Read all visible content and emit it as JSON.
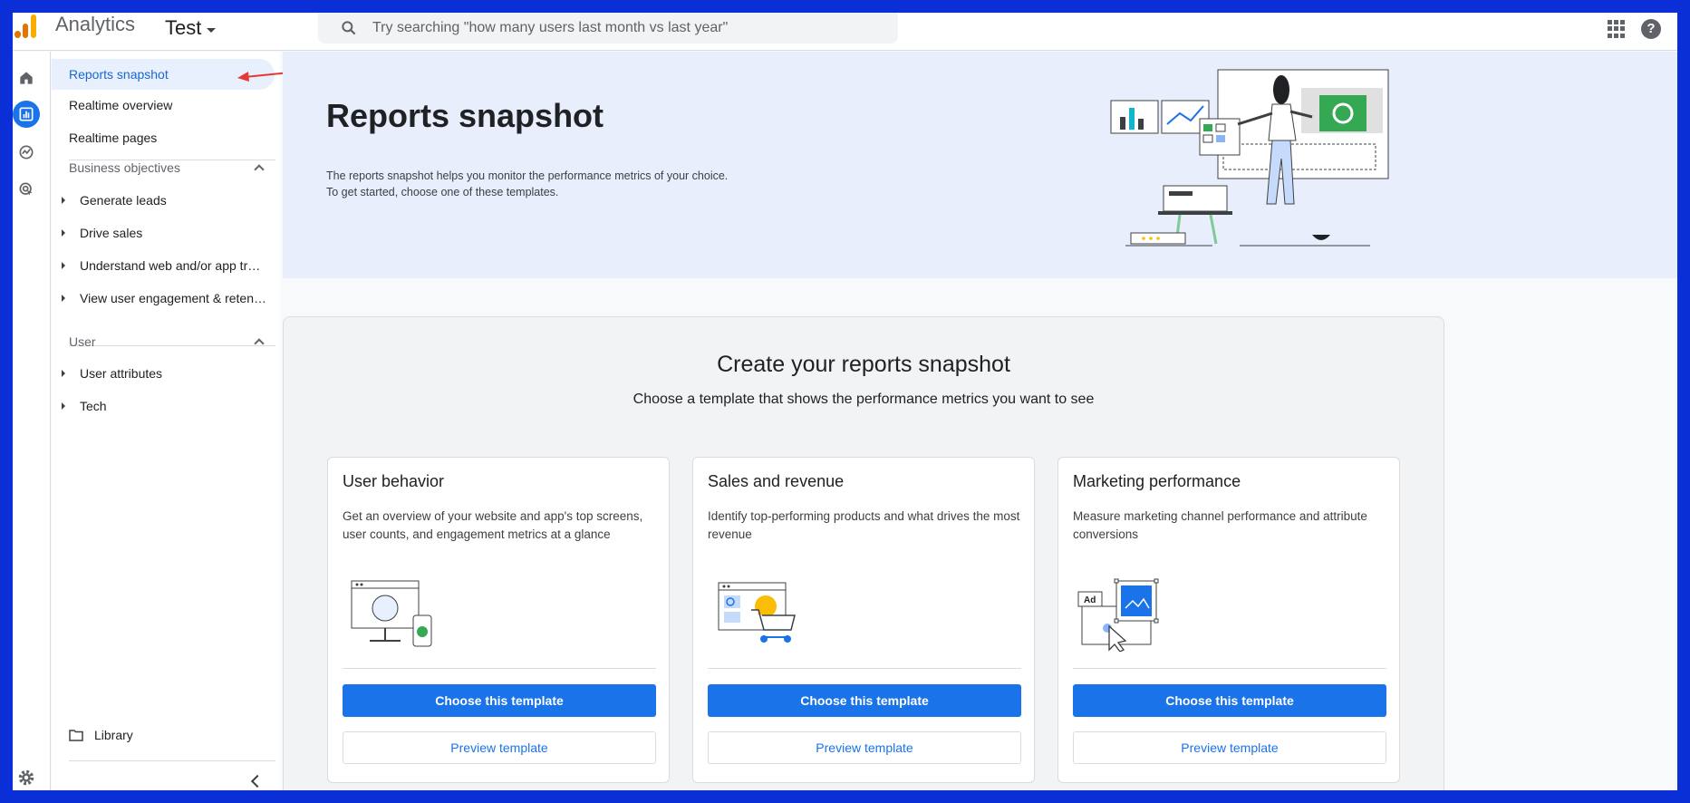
{
  "header": {
    "app_name": "Analytics",
    "property": "Test",
    "search_placeholder": "Try searching \"how many users last month vs last year\""
  },
  "sidebar": {
    "top_items": [
      "Reports snapshot",
      "Realtime overview",
      "Realtime pages"
    ],
    "sections": [
      {
        "title": "Business objectives",
        "items": [
          "Generate leads",
          "Drive sales",
          "Understand web and/or app traffic",
          "View user engagement & retention"
        ]
      },
      {
        "title": "User",
        "items": [
          "User attributes",
          "Tech"
        ]
      }
    ],
    "library": "Library"
  },
  "hero": {
    "title": "Reports snapshot",
    "line1": "The reports snapshot helps you monitor the performance metrics of your choice.",
    "line2": "To get started, choose one of these templates."
  },
  "panel": {
    "title": "Create your reports snapshot",
    "subtitle": "Choose a template that shows the performance metrics you want to see",
    "cards": [
      {
        "title": "User behavior",
        "desc": "Get an overview of your website and app's top screens, user counts, and engagement metrics at a glance",
        "primary": "Choose this template",
        "secondary": "Preview template"
      },
      {
        "title": "Sales and revenue",
        "desc": "Identify top-performing products and what drives the most revenue",
        "primary": "Choose this template",
        "secondary": "Preview template"
      },
      {
        "title": "Marketing performance",
        "desc": "Measure marketing channel performance and attribute conversions",
        "primary": "Choose this template",
        "secondary": "Preview template"
      }
    ]
  },
  "colors": {
    "accent": "#1a73e8",
    "hero_bg": "#e8eefc",
    "annotation": "#e53935"
  }
}
